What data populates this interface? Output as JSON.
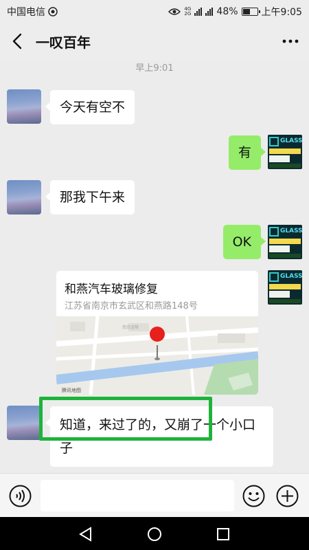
{
  "status_bar": {
    "carrier": "中国电信",
    "signal_label": "4G 2G",
    "battery": "48%",
    "battery_level": 0.48,
    "time": "上午9:05"
  },
  "header": {
    "title": "一叹百年"
  },
  "timestamp": "早上9:01",
  "messages": [
    {
      "side": "in",
      "text": "今天有空不"
    },
    {
      "side": "out",
      "text": "有"
    },
    {
      "side": "in",
      "text": "那我下午来"
    },
    {
      "side": "out",
      "text": "OK"
    },
    {
      "side": "out",
      "type": "location",
      "name": "和燕汽车玻璃修复",
      "address": "江苏省南京市玄武区和燕路148号",
      "map_attribution": "腾讯地图"
    },
    {
      "side": "in",
      "text": "知道，来过了的，又崩了一个小口子"
    }
  ],
  "avatar_right_brand": "GLASS",
  "input": {
    "placeholder": ""
  },
  "colors": {
    "outgoing_bubble": "#95ec69",
    "incoming_bubble": "#ffffff",
    "highlight": "#1db33a",
    "background": "#ececec"
  },
  "icons": [
    "back-icon",
    "more-icon",
    "voice-icon",
    "emoji-icon",
    "plus-icon",
    "nav-back-icon",
    "nav-home-icon",
    "nav-recents-icon"
  ]
}
